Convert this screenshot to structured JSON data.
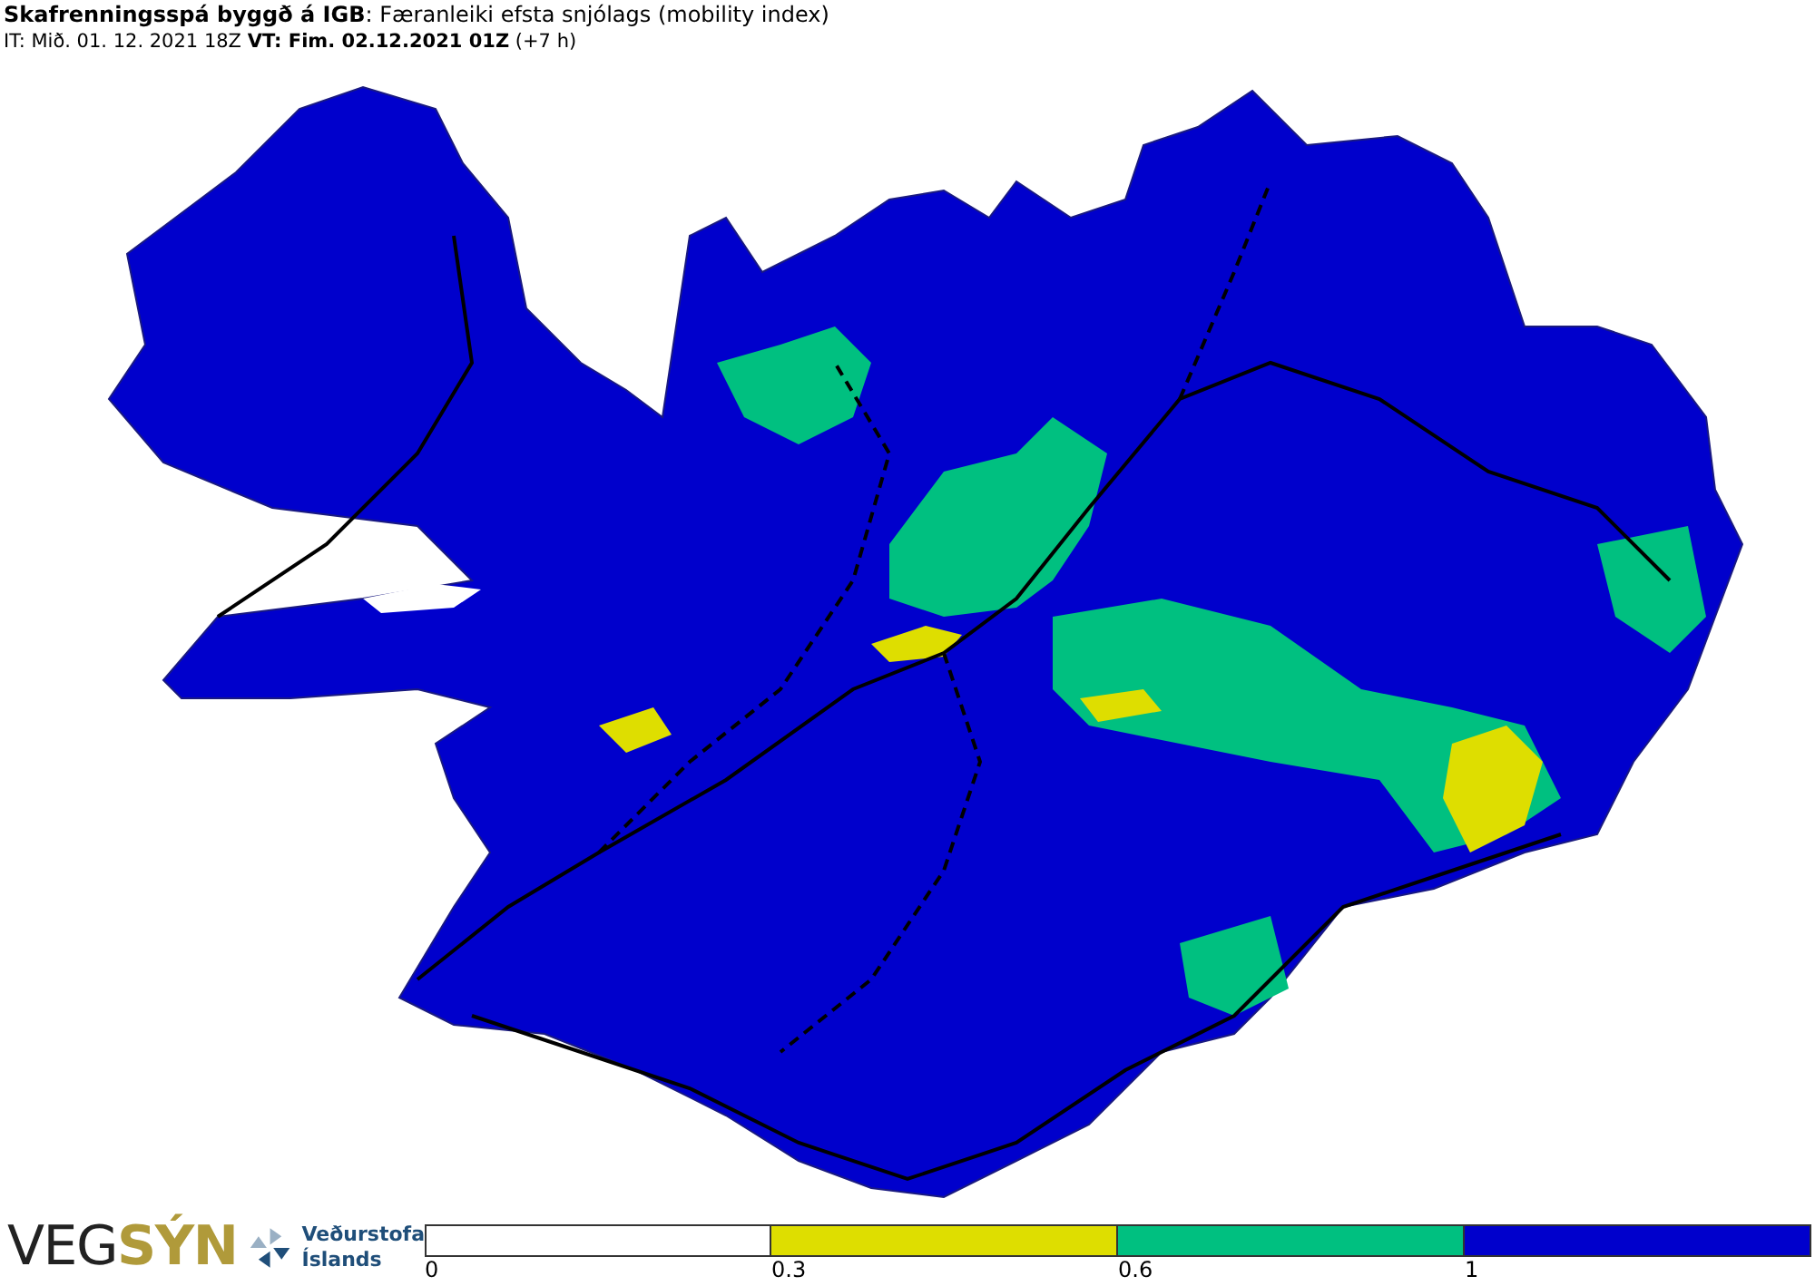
{
  "header": {
    "title": "**Skafrenningsspá byggð á IGB**: Færanleiki efsta snjólags (mobility index)",
    "subtitle": "IT: Mið. 01. 12. 2021 18Z **VT: Fim. 02.12.2021 01Z** (+7 h)"
  },
  "logos": {
    "primary": [
      "VEG",
      "SÝN"
    ],
    "secondary": [
      "Veðurstofa",
      "Íslands"
    ]
  },
  "legend": [
    {
      "color": "#ffffff",
      "label": "0"
    },
    {
      "color": "#dede00",
      "label": "0.3"
    },
    {
      "color": "#00c080",
      "label": "0.6"
    },
    {
      "color": "#0000cc",
      "label": "1"
    }
  ]
}
